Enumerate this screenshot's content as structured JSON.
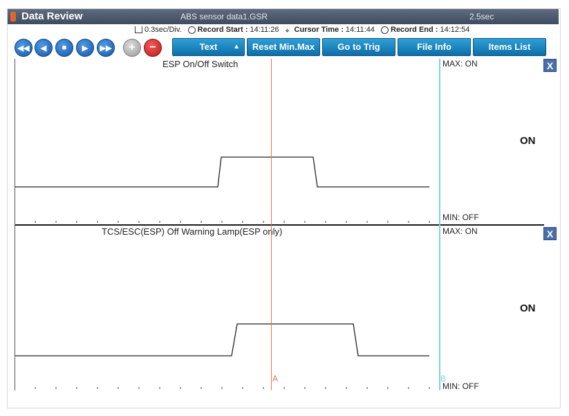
{
  "window": {
    "title": "Data Review",
    "file_name": "ABS sensor data1.GSR",
    "duration": "2.5sec"
  },
  "info_bar": {
    "division": "0.3sec/Div.",
    "record_start_label": "Record Start :",
    "record_start": "14:11:26",
    "cursor_time_label": "Cursor Time :",
    "cursor_time": "14:11:44",
    "record_end_label": "Record End :",
    "record_end": "14:12:54"
  },
  "toolbar": {
    "nav_icons": [
      "rewind-icon",
      "step-back-icon",
      "stop-icon",
      "play-icon",
      "fast-forward-icon",
      "zoom-in-icon",
      "zoom-out-icon"
    ],
    "text_select": "Text",
    "reset_label": "Reset Min.Max",
    "goto_trig_label": "Go to Trig",
    "file_info_label": "File Info",
    "items_list_label": "Items List"
  },
  "panels": [
    {
      "title": "ESP On/Off Switch",
      "max_label": "MAX: ON",
      "min_label": "MIN: OFF",
      "current_value": "ON",
      "close": "X"
    },
    {
      "title": "TCS/ESC(ESP) Off Warning Lamp(ESP only)",
      "max_label": "MAX: ON",
      "min_label": "MIN: OFF",
      "current_value": "ON",
      "close": "X"
    }
  ],
  "cursors": {
    "a_label": "A",
    "b_label": "B"
  },
  "colors": {
    "title_bar": "#4b5668",
    "toolbar_button": "#1a86c4",
    "nav_button": "#1f6fc0",
    "cursor_a": "#e0774a",
    "cursor_b": "#7ed3dc",
    "signal": "#222222"
  }
}
